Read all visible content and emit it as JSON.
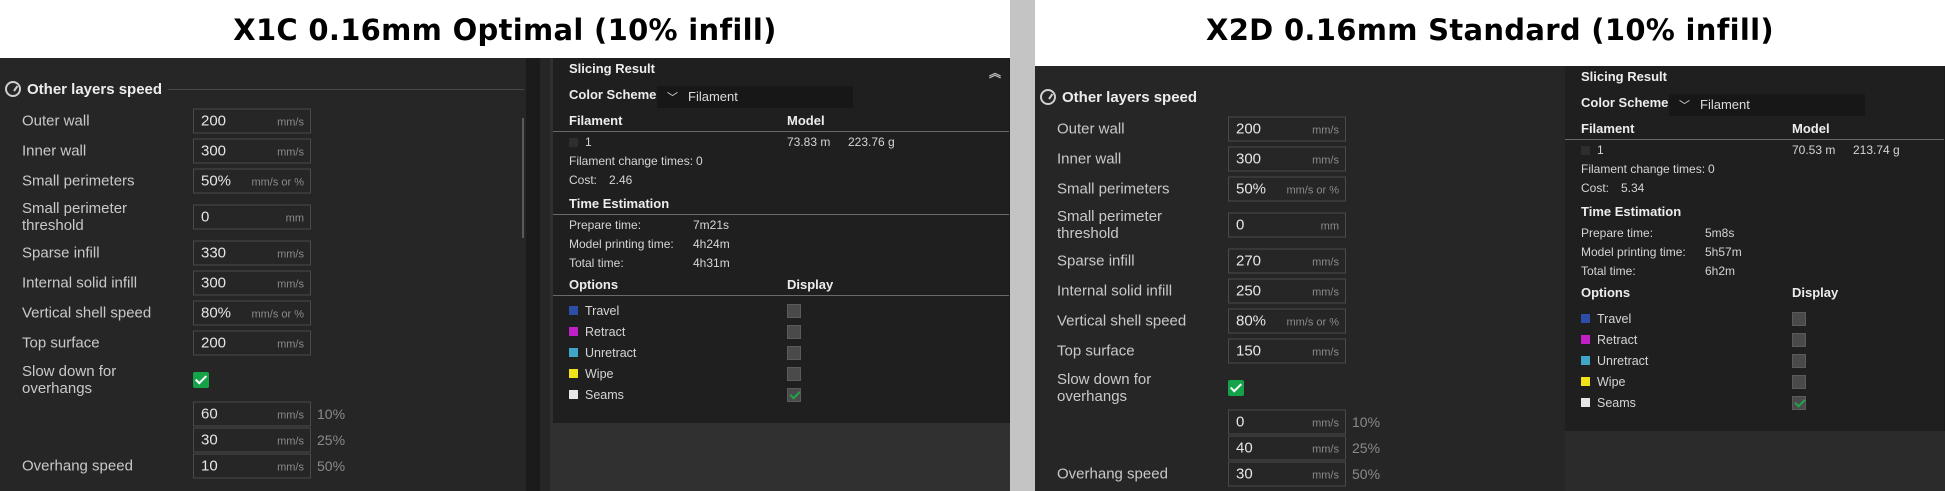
{
  "left": {
    "title": "X1C 0.16mm Optimal (10% infill)",
    "section_title": "Other layers speed",
    "settings": [
      {
        "label": "Outer wall",
        "value": "200",
        "unit": "mm/s"
      },
      {
        "label": "Inner wall",
        "value": "300",
        "unit": "mm/s"
      },
      {
        "label": "Small perimeters",
        "value": "50%",
        "unit": "mm/s or %"
      },
      {
        "label": "Small perimeter threshold",
        "value": "0",
        "unit": "mm"
      },
      {
        "label": "Sparse infill",
        "value": "330",
        "unit": "mm/s"
      },
      {
        "label": "Internal solid infill",
        "value": "300",
        "unit": "mm/s"
      },
      {
        "label": "Vertical shell speed",
        "value": "80%",
        "unit": "mm/s or %"
      },
      {
        "label": "Top surface",
        "value": "200",
        "unit": "mm/s"
      }
    ],
    "slow_down_label": "Slow down for overhangs",
    "overhangs": [
      {
        "value": "60",
        "unit": "mm/s",
        "pct": "10%"
      },
      {
        "value": "30",
        "unit": "mm/s",
        "pct": "25%"
      },
      {
        "value": "10",
        "unit": "mm/s",
        "pct": "50%"
      }
    ],
    "overhang_speed_label": "Overhang speed",
    "result": {
      "title": "Slicing Result",
      "color_scheme_label": "Color Scheme",
      "color_scheme_value": "Filament",
      "filament_header": "Filament",
      "model_header": "Model",
      "filament_id": "1",
      "length": "73.83 m",
      "weight": "223.76 g",
      "change_times_label": "Filament change times:",
      "change_times": "0",
      "cost_label": "Cost:",
      "cost": "2.46",
      "time_title": "Time Estimation",
      "prepare_label": "Prepare time:",
      "prepare": "7m21s",
      "model_time_label": "Model printing time:",
      "model_time": "4h24m",
      "total_label": "Total time:",
      "total": "4h31m",
      "options_header": "Options",
      "display_header": "Display",
      "options": [
        {
          "label": "Travel",
          "color": "#2b4ea8",
          "checked": false
        },
        {
          "label": "Retract",
          "color": "#c21fc7",
          "checked": false
        },
        {
          "label": "Unretract",
          "color": "#3fa6c9",
          "checked": false
        },
        {
          "label": "Wipe",
          "color": "#f2e21a",
          "checked": false
        },
        {
          "label": "Seams",
          "color": "#e6e6e6",
          "checked": true
        }
      ]
    }
  },
  "right": {
    "title": "X2D 0.16mm Standard (10% infill)",
    "section_title": "Other layers speed",
    "settings": [
      {
        "label": "Outer wall",
        "value": "200",
        "unit": "mm/s"
      },
      {
        "label": "Inner wall",
        "value": "300",
        "unit": "mm/s"
      },
      {
        "label": "Small perimeters",
        "value": "50%",
        "unit": "mm/s or %"
      },
      {
        "label": "Small perimeter threshold",
        "value": "0",
        "unit": "mm"
      },
      {
        "label": "Sparse infill",
        "value": "270",
        "unit": "mm/s"
      },
      {
        "label": "Internal solid infill",
        "value": "250",
        "unit": "mm/s"
      },
      {
        "label": "Vertical shell speed",
        "value": "80%",
        "unit": "mm/s or %"
      },
      {
        "label": "Top surface",
        "value": "150",
        "unit": "mm/s"
      }
    ],
    "slow_down_label": "Slow down for overhangs",
    "overhangs": [
      {
        "value": "0",
        "unit": "mm/s",
        "pct": "10%"
      },
      {
        "value": "40",
        "unit": "mm/s",
        "pct": "25%"
      },
      {
        "value": "30",
        "unit": "mm/s",
        "pct": "50%"
      }
    ],
    "overhang_speed_label": "Overhang speed",
    "result": {
      "title": "Slicing Result",
      "color_scheme_label": "Color Scheme",
      "color_scheme_value": "Filament",
      "filament_header": "Filament",
      "model_header": "Model",
      "filament_id": "1",
      "length": "70.53 m",
      "weight": "213.74 g",
      "change_times_label": "Filament change times:",
      "change_times": "0",
      "cost_label": "Cost:",
      "cost": "5.34",
      "time_title": "Time Estimation",
      "prepare_label": "Prepare time:",
      "prepare": "5m8s",
      "model_time_label": "Model printing time:",
      "model_time": "5h57m",
      "total_label": "Total time:",
      "total": "6h2m",
      "options_header": "Options",
      "display_header": "Display",
      "options": [
        {
          "label": "Travel",
          "color": "#2b4ea8",
          "checked": false
        },
        {
          "label": "Retract",
          "color": "#c21fc7",
          "checked": false
        },
        {
          "label": "Unretract",
          "color": "#3fa6c9",
          "checked": false
        },
        {
          "label": "Wipe",
          "color": "#f2e21a",
          "checked": false
        },
        {
          "label": "Seams",
          "color": "#e6e6e6",
          "checked": true
        }
      ]
    }
  }
}
